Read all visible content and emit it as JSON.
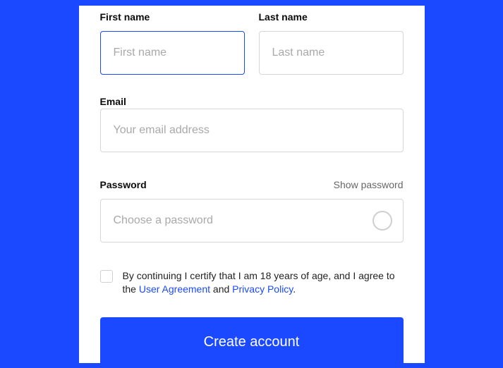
{
  "first_name": {
    "label": "First name",
    "placeholder": "First name",
    "value": ""
  },
  "last_name": {
    "label": "Last name",
    "placeholder": "Last name",
    "value": ""
  },
  "email": {
    "label": "Email",
    "placeholder": "Your email address",
    "value": ""
  },
  "password": {
    "label": "Password",
    "show_toggle": "Show password",
    "placeholder": "Choose a password",
    "value": ""
  },
  "consent": {
    "pre": "By continuing I certify that I am 18 years of age, and I agree to the ",
    "user_agreement": "User Agreement",
    "and": " and ",
    "privacy_policy": "Privacy Policy",
    "suffix": "."
  },
  "submit_label": "Create account"
}
